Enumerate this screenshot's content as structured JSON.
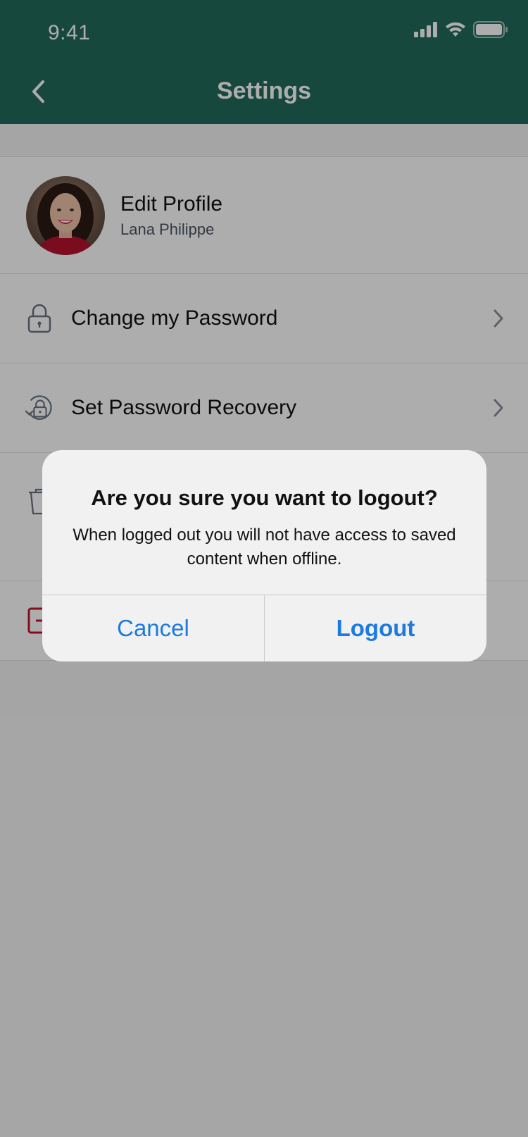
{
  "status_bar": {
    "time": "9:41"
  },
  "nav": {
    "title": "Settings"
  },
  "profile": {
    "title": "Edit Profile",
    "name": "Lana Philippe"
  },
  "settings_items": [
    {
      "label": "Change my Password",
      "icon": "lock-icon"
    },
    {
      "label": "Set Password Recovery",
      "icon": "lock-recovery-icon"
    }
  ],
  "alert": {
    "title": "Are you sure you want to logout?",
    "message": "When logged out you will not have access to saved content when offline.",
    "cancel_label": "Cancel",
    "confirm_label": "Logout"
  },
  "colors": {
    "header": "#226a5b",
    "accent_blue": "#1c7ae0",
    "danger_red": "#c8102e"
  }
}
